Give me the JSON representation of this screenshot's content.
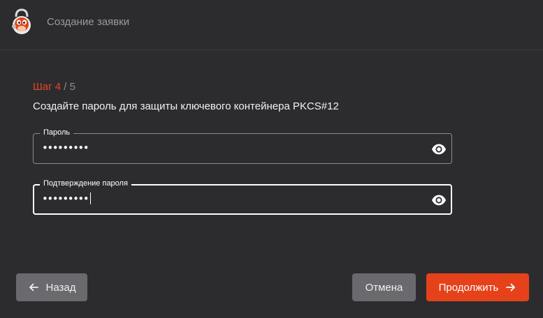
{
  "header": {
    "title": "Создание заявки",
    "logo_icon": "mascot-logo-icon"
  },
  "form": {
    "step_current": "Шаг 4",
    "step_total": " / 5",
    "subtitle": "Создайте пароль для защиты ключевого контейнера PKCS#12",
    "password": {
      "label": "Пароль",
      "value": "•••••••••",
      "icon": "eye-icon"
    },
    "password_confirm": {
      "label": "Подтверждение пароля",
      "value": "•••••••••",
      "icon": "eye-icon"
    }
  },
  "footer": {
    "back_label": "Назад",
    "cancel_label": "Отмена",
    "next_label": "Продолжить"
  },
  "colors": {
    "accent": "#e5421b",
    "background": "#2c2c2e",
    "secondary_button": "#6a6a6e"
  }
}
